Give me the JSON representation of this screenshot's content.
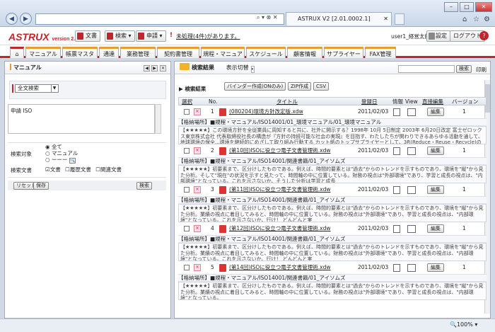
{
  "browser": {
    "url": "",
    "tab_title": "ASTRUX V2 [2.01.0002.1]",
    "search_tools": "⌕ ▾ ⊗ ✕",
    "zoom": "100%"
  },
  "app": {
    "logo": "ASTRUX",
    "version": "version 2.0",
    "buttons": {
      "document": "文書",
      "search": "検索",
      "application": "申請"
    },
    "alert": "未処理(4件)があります。",
    "user": "user1_経営太郎",
    "settings": "設定",
    "logout": "ログアウト",
    "help": "?"
  },
  "menu": [
    "マニュアル",
    "帳票マスタ",
    "通達",
    "業務管理",
    "契約書管理",
    "規程・マニュアル",
    "スケジュール",
    "顧客情報",
    "サプライヤー",
    "FAX管理"
  ],
  "left": {
    "title": "マニュアル",
    "search_type": "全文検索",
    "query": "申請 ISO",
    "target_label": "検索対象",
    "targets": [
      "全て",
      "マニュアル",
      "ーーー"
    ],
    "doc_label": "検索文書",
    "docs": [
      "文書",
      "履歴文書",
      "関連文書"
    ],
    "reset": "リセット",
    "save": "保存",
    "search": "検索"
  },
  "right": {
    "title": "検索結果",
    "switch": "表示切替",
    "search_btn": "検索",
    "print": "印刷",
    "results_label": "検索結果",
    "binder": "バインダー作成(ONのみ)",
    "zip": "ZIP作成",
    "csv": "CSV",
    "headers": {
      "select": "選択",
      "no": "No.",
      "title": "タイトル",
      "reg": "登録日",
      "info": "情報",
      "view": "View",
      "edit": "直接編集",
      "version": "バージョン"
    },
    "edit_btn": "編集",
    "rows": [
      {
        "no": "1",
        "title": "(080204)環境方針改定版.xdw",
        "date": "2011/02/03",
        "ver": "1",
        "loc": "【格納場所】■規程・マニュアル/ISO14001/01_環境マニュアル/01_環境マニュアル",
        "desc": "【★★★★★】この環境方針を全従業員に周知すると共に、社外に開示する？1998年 10月 5日制定 2003年 6月20日改定 富士ゼロックス東京株式会社 代表取締役社長の構造が『方針の持続可能な社会の実現』を目指す、わたしたちが関わりできるあらゆる活動を通して、地球環境の保全...環境を継続的にめざして取り組み行動する カット紙のトップサプライヤーとして、3R(Reduce・Reuse・Recycle)の 視点に立った方策"
      },
      {
        "no": "2",
        "title": "(第10回)ISOに役立つ電子文書管理術.xdw",
        "date": "2011/02/03",
        "ver": "1",
        "loc": "【格納場所】■規程・マニュアル/ISO14001/関連書籍/01_アイソムズ",
        "desc": "【★★★★★】初要素まで、区分けしたものである。例えば、時間的要素とは\"過去\"からのトレンドを示すものであり、環境を\"縦\"から見た分析。そして\"現在\"の状況を示すと見たって、時間軸の中に位置している。財務の視点は\"外部環境\"であり、学習と成長の視点は、\"内部環境\"となっている。これを示さないか、そうした分析は学習と成長"
      },
      {
        "no": "3",
        "title": "(第11回)ISOに役立つ電子文書管理術.xdw",
        "date": "2011/02/03",
        "ver": "1",
        "loc": "【格納場所】■規程・マニュアル/ISO14001/関連書籍/01_アイソムズ",
        "desc": "【★★★★★】初要素まで、区分けしたものである。例えば、時間的要素とは\"過去\"からのトレンドを示すものであり、環境を\"縦\"から見た分析。業績の視点に着目してみると、時間軸の中に位置している。財務の視点は\"外部環境\"であり、学習と成長の視点は、\"内部環境\"となっている。これを示さないか、行け！ どんどんと実"
      },
      {
        "no": "4",
        "title": "(第12回)ISOに役立つ電子文書管理術.xdw",
        "date": "2011/02/03",
        "ver": "1",
        "loc": "【格納場所】■規程・マニュアル/ISO14001/関連書籍/01_アイソムズ",
        "desc": "【★★★★★】初要素まで、区分けしたものである。例えば、時間的要素とは\"過去\"からのトレンドを示すものであり、環境を\"縦\"から見た分析。業績の視点に着目してみると、時間軸の中に位置している。財務の視点は\"外部環境\"であり、学習と成長の視点は、\"内部環境\"となっている。これを示さないか、行け！ どんどんと実"
      },
      {
        "no": "5",
        "title": "(第14回)ISOに役立つ電子文書管理術.xdw",
        "date": "2011/02/03",
        "ver": "1",
        "loc": "【格納場所】■規程・マニュアル/ISO14001/関連書籍/01_アイソムズ",
        "desc": "【★★★★★】初要素まで、区分けしたものである。例えば、時間的要素とは\"過去\"からのトレンドを示すものであり、環境を\"縦\"から見た分析。業績の視点に着目してみると、時間軸の中に位置している。財務の視点は\"外部環境\"であり、学習と成長の視点は、\"内部環境\"となっている。"
      }
    ]
  }
}
